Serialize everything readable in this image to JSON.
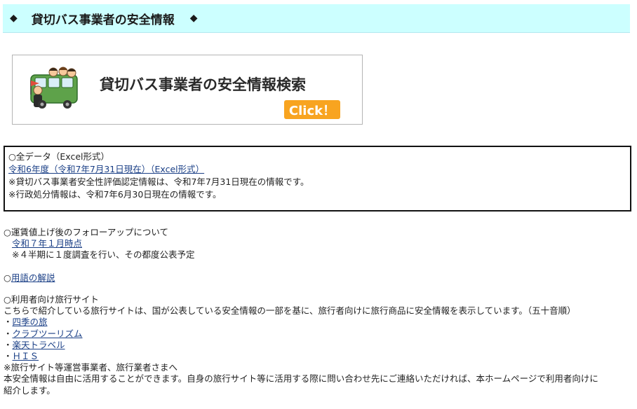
{
  "header": {
    "diamond_left": "◆",
    "title": "貸切バス事業者の安全情報",
    "diamond_right": "◆"
  },
  "banner": {
    "text": "貸切バス事業者の安全情報検索",
    "click_label": "Click！"
  },
  "data_box": {
    "heading": "○全データ（Excel形式）",
    "link": "令和6年度（令和7年7月31日現在）（Excel形式）",
    "note1": "※貸切バス事業者安全性評価認定情報は、令和7年7月31日現在の情報です。",
    "note2": "※行政処分情報は、令和7年6月30日現在の情報です。"
  },
  "followup": {
    "heading": "○運賃値上げ後のフォローアップについて",
    "link": "令和７年１月時点",
    "note": "※４半期に１度調査を行い、その都度公表予定"
  },
  "glossary": {
    "prefix": "○",
    "link": "用語の解説"
  },
  "travel": {
    "heading": "○利用者向け旅行サイト",
    "desc": "こちらで紹介している旅行サイトは、国が公表している安全情報の一部を基に、旅行者向けに旅行商品に安全情報を表示しています。（五十音順）",
    "bullet": "・",
    "sites": [
      "四季の旅",
      "クラブツーリズム",
      "楽天トラベル",
      "ＨＩＳ"
    ],
    "note_heading": "※旅行サイト等運営事業者、旅行業者さまへ",
    "note_line1": "本安全情報は自由に活用することができます。自身の旅行サイト等に活用する際に問い合わせ先にご連絡いただければ、本ホームページで利用者向けに",
    "note_line2": "紹介します。"
  },
  "colors": {
    "title_bg": "#ccffff",
    "link": "#1a3f86",
    "click_button": "#f8a420"
  },
  "icons": {
    "banner_image": "bus-illustration-icon"
  }
}
